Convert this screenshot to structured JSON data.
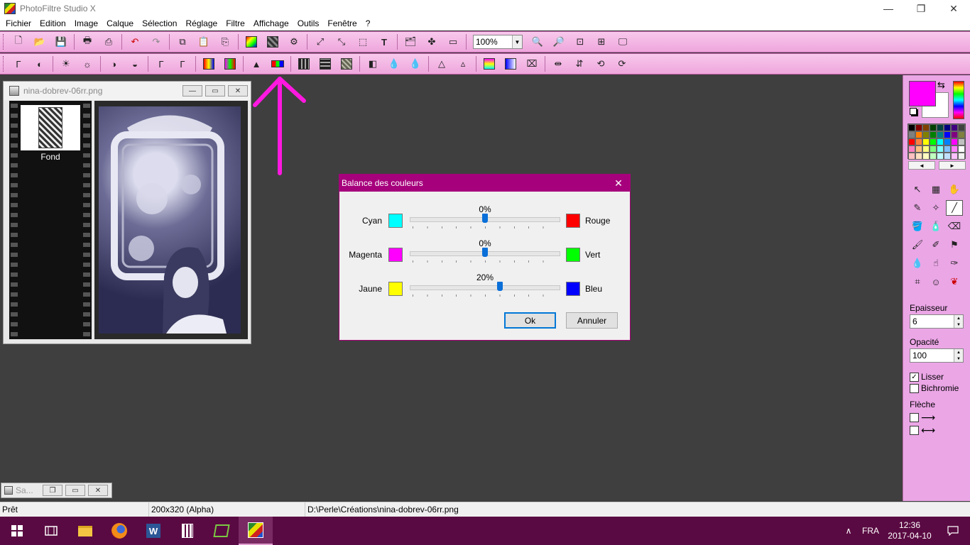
{
  "window": {
    "title": "PhotoFiltre Studio X",
    "minimize": "—",
    "maximize": "❐",
    "close": "✕"
  },
  "menu": [
    "Fichier",
    "Edition",
    "Image",
    "Calque",
    "Sélection",
    "Réglage",
    "Filtre",
    "Affichage",
    "Outils",
    "Fenêtre",
    "?"
  ],
  "toolbar": {
    "zoom_value": "100%"
  },
  "image_window": {
    "title": "nina-dobrev-06rr.png",
    "layer_name": "Fond"
  },
  "dialog": {
    "title": "Balance des couleurs",
    "rows": [
      {
        "left_label": "Cyan",
        "left_color": "#00ffff",
        "right_label": "Rouge",
        "right_color": "#ff0000",
        "value_text": "0%",
        "value": 0
      },
      {
        "left_label": "Magenta",
        "left_color": "#ff00ff",
        "right_label": "Vert",
        "right_color": "#00ff00",
        "value_text": "0%",
        "value": 0
      },
      {
        "left_label": "Jaune",
        "left_color": "#ffff00",
        "right_label": "Bleu",
        "right_color": "#0000ff",
        "value_text": "20%",
        "value": 20
      }
    ],
    "ok_label": "Ok",
    "cancel_label": "Annuler"
  },
  "right_panel": {
    "foreground_color": "#ff00ff",
    "background_color": "#ffffff",
    "palette": [
      "#000000",
      "#800000",
      "#804000",
      "#004000",
      "#004040",
      "#000080",
      "#400080",
      "#404040",
      "#808080",
      "#ff8000",
      "#808000",
      "#008000",
      "#008080",
      "#0000ff",
      "#800080",
      "#808040",
      "#ff0000",
      "#ff8040",
      "#ffff00",
      "#00ff00",
      "#00ffff",
      "#0080ff",
      "#ff00ff",
      "#c0c0c0",
      "#ff80c0",
      "#ffc080",
      "#ffff80",
      "#80ff80",
      "#80ffff",
      "#80c0ff",
      "#ff80ff",
      "#ffffff",
      "#ffc0c0",
      "#ffe0c0",
      "#ffffc0",
      "#c0ffc0",
      "#c0ffff",
      "#c0e0ff",
      "#ffc0ff",
      "#f0f0f0"
    ],
    "palette_prev": "◄",
    "palette_next": "►",
    "epaisseur_label": "Epaisseur",
    "epaisseur_value": "6",
    "opacite_label": "Opacité",
    "opacite_value": "100",
    "lisser_label": "Lisser",
    "lisser_checked": true,
    "bichromie_label": "Bichromie",
    "bichromie_checked": false,
    "fleche_label": "Flèche"
  },
  "minimized_window": {
    "title": "Sa..."
  },
  "status": {
    "state": "Prêt",
    "dimensions": "200x320 (Alpha)",
    "path": "D:\\Perle\\Créations\\nina-dobrev-06rr.png"
  },
  "taskbar": {
    "language": "FRA",
    "time": "12:36",
    "date": "2017-04-10"
  }
}
